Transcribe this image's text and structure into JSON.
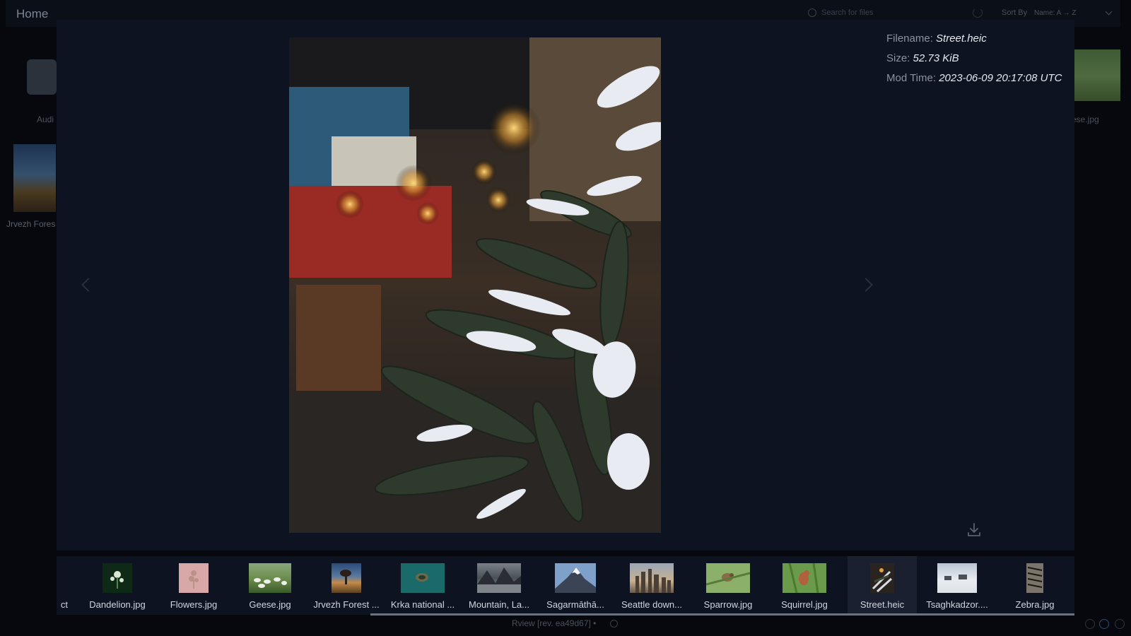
{
  "background": {
    "title": "Home",
    "search_placeholder": "Search for files",
    "sort_label": "Sort By",
    "sort_value": "Name: A → Z",
    "folder_label": "Audi",
    "left_tile_label": "Jrvezh Fores",
    "right_tile_label": "ese.jpg"
  },
  "viewer": {
    "filename_label": "Filename:",
    "filename": "Street.heic",
    "size_label": "Size:",
    "size": "52.73 KiB",
    "modtime_label": "Mod Time:",
    "modtime": "2023-06-09 20:17:08 UTC"
  },
  "filmstrip": [
    {
      "label": "ct",
      "selected": false
    },
    {
      "label": "Dandelion.jpg",
      "selected": false
    },
    {
      "label": "Flowers.jpg",
      "selected": false
    },
    {
      "label": "Geese.jpg",
      "selected": false
    },
    {
      "label": "Jrvezh Forest ...",
      "selected": false
    },
    {
      "label": "Krka national ...",
      "selected": false
    },
    {
      "label": "Mountain, La...",
      "selected": false
    },
    {
      "label": "Sagarmāthā...",
      "selected": false
    },
    {
      "label": "Seattle down...",
      "selected": false
    },
    {
      "label": "Sparrow.jpg",
      "selected": false
    },
    {
      "label": "Squirrel.jpg",
      "selected": false
    },
    {
      "label": "Street.heic",
      "selected": true
    },
    {
      "label": "Tsaghkadzor....",
      "selected": false
    },
    {
      "label": "Zebra.jpg",
      "selected": false
    }
  ],
  "footer": {
    "version": "Rview [rev. ea49d67] •"
  }
}
